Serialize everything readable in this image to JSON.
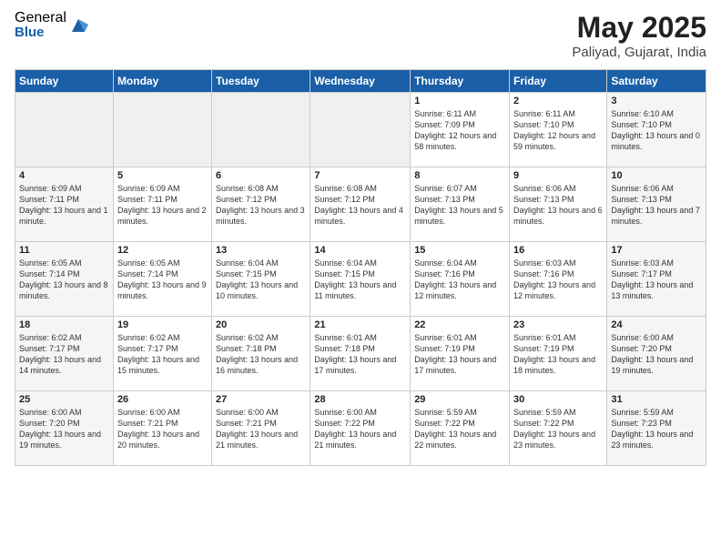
{
  "logo": {
    "general": "General",
    "blue": "Blue"
  },
  "title": "May 2025",
  "subtitle": "Paliyad, Gujarat, India",
  "days_of_week": [
    "Sunday",
    "Monday",
    "Tuesday",
    "Wednesday",
    "Thursday",
    "Friday",
    "Saturday"
  ],
  "weeks": [
    [
      {
        "day": "",
        "info": "",
        "empty": true
      },
      {
        "day": "",
        "info": "",
        "empty": true
      },
      {
        "day": "",
        "info": "",
        "empty": true
      },
      {
        "day": "",
        "info": "",
        "empty": true
      },
      {
        "day": "1",
        "info": "Sunrise: 6:11 AM\nSunset: 7:09 PM\nDaylight: 12 hours\nand 58 minutes.",
        "empty": false
      },
      {
        "day": "2",
        "info": "Sunrise: 6:11 AM\nSunset: 7:10 PM\nDaylight: 12 hours\nand 59 minutes.",
        "empty": false
      },
      {
        "day": "3",
        "info": "Sunrise: 6:10 AM\nSunset: 7:10 PM\nDaylight: 13 hours\nand 0 minutes.",
        "empty": false
      }
    ],
    [
      {
        "day": "4",
        "info": "Sunrise: 6:09 AM\nSunset: 7:11 PM\nDaylight: 13 hours\nand 1 minute.",
        "empty": false
      },
      {
        "day": "5",
        "info": "Sunrise: 6:09 AM\nSunset: 7:11 PM\nDaylight: 13 hours\nand 2 minutes.",
        "empty": false
      },
      {
        "day": "6",
        "info": "Sunrise: 6:08 AM\nSunset: 7:12 PM\nDaylight: 13 hours\nand 3 minutes.",
        "empty": false
      },
      {
        "day": "7",
        "info": "Sunrise: 6:08 AM\nSunset: 7:12 PM\nDaylight: 13 hours\nand 4 minutes.",
        "empty": false
      },
      {
        "day": "8",
        "info": "Sunrise: 6:07 AM\nSunset: 7:13 PM\nDaylight: 13 hours\nand 5 minutes.",
        "empty": false
      },
      {
        "day": "9",
        "info": "Sunrise: 6:06 AM\nSunset: 7:13 PM\nDaylight: 13 hours\nand 6 minutes.",
        "empty": false
      },
      {
        "day": "10",
        "info": "Sunrise: 6:06 AM\nSunset: 7:13 PM\nDaylight: 13 hours\nand 7 minutes.",
        "empty": false
      }
    ],
    [
      {
        "day": "11",
        "info": "Sunrise: 6:05 AM\nSunset: 7:14 PM\nDaylight: 13 hours\nand 8 minutes.",
        "empty": false
      },
      {
        "day": "12",
        "info": "Sunrise: 6:05 AM\nSunset: 7:14 PM\nDaylight: 13 hours\nand 9 minutes.",
        "empty": false
      },
      {
        "day": "13",
        "info": "Sunrise: 6:04 AM\nSunset: 7:15 PM\nDaylight: 13 hours\nand 10 minutes.",
        "empty": false
      },
      {
        "day": "14",
        "info": "Sunrise: 6:04 AM\nSunset: 7:15 PM\nDaylight: 13 hours\nand 11 minutes.",
        "empty": false
      },
      {
        "day": "15",
        "info": "Sunrise: 6:04 AM\nSunset: 7:16 PM\nDaylight: 13 hours\nand 12 minutes.",
        "empty": false
      },
      {
        "day": "16",
        "info": "Sunrise: 6:03 AM\nSunset: 7:16 PM\nDaylight: 13 hours\nand 12 minutes.",
        "empty": false
      },
      {
        "day": "17",
        "info": "Sunrise: 6:03 AM\nSunset: 7:17 PM\nDaylight: 13 hours\nand 13 minutes.",
        "empty": false
      }
    ],
    [
      {
        "day": "18",
        "info": "Sunrise: 6:02 AM\nSunset: 7:17 PM\nDaylight: 13 hours\nand 14 minutes.",
        "empty": false
      },
      {
        "day": "19",
        "info": "Sunrise: 6:02 AM\nSunset: 7:17 PM\nDaylight: 13 hours\nand 15 minutes.",
        "empty": false
      },
      {
        "day": "20",
        "info": "Sunrise: 6:02 AM\nSunset: 7:18 PM\nDaylight: 13 hours\nand 16 minutes.",
        "empty": false
      },
      {
        "day": "21",
        "info": "Sunrise: 6:01 AM\nSunset: 7:18 PM\nDaylight: 13 hours\nand 17 minutes.",
        "empty": false
      },
      {
        "day": "22",
        "info": "Sunrise: 6:01 AM\nSunset: 7:19 PM\nDaylight: 13 hours\nand 17 minutes.",
        "empty": false
      },
      {
        "day": "23",
        "info": "Sunrise: 6:01 AM\nSunset: 7:19 PM\nDaylight: 13 hours\nand 18 minutes.",
        "empty": false
      },
      {
        "day": "24",
        "info": "Sunrise: 6:00 AM\nSunset: 7:20 PM\nDaylight: 13 hours\nand 19 minutes.",
        "empty": false
      }
    ],
    [
      {
        "day": "25",
        "info": "Sunrise: 6:00 AM\nSunset: 7:20 PM\nDaylight: 13 hours\nand 19 minutes.",
        "empty": false
      },
      {
        "day": "26",
        "info": "Sunrise: 6:00 AM\nSunset: 7:21 PM\nDaylight: 13 hours\nand 20 minutes.",
        "empty": false
      },
      {
        "day": "27",
        "info": "Sunrise: 6:00 AM\nSunset: 7:21 PM\nDaylight: 13 hours\nand 21 minutes.",
        "empty": false
      },
      {
        "day": "28",
        "info": "Sunrise: 6:00 AM\nSunset: 7:22 PM\nDaylight: 13 hours\nand 21 minutes.",
        "empty": false
      },
      {
        "day": "29",
        "info": "Sunrise: 5:59 AM\nSunset: 7:22 PM\nDaylight: 13 hours\nand 22 minutes.",
        "empty": false
      },
      {
        "day": "30",
        "info": "Sunrise: 5:59 AM\nSunset: 7:22 PM\nDaylight: 13 hours\nand 23 minutes.",
        "empty": false
      },
      {
        "day": "31",
        "info": "Sunrise: 5:59 AM\nSunset: 7:23 PM\nDaylight: 13 hours\nand 23 minutes.",
        "empty": false
      }
    ]
  ]
}
